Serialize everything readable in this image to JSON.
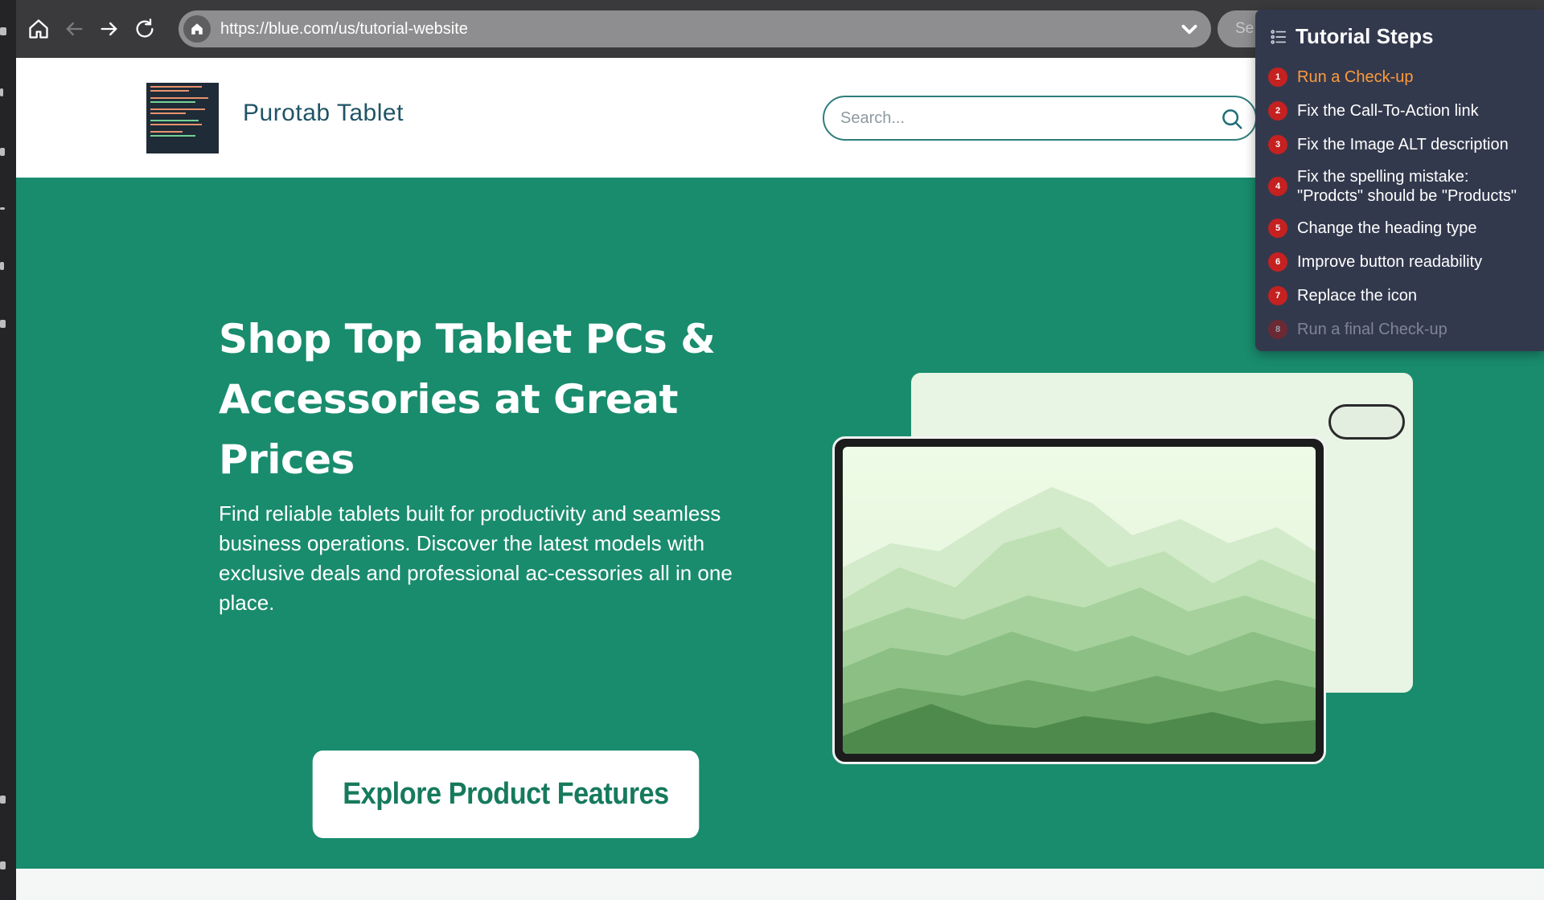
{
  "browser": {
    "url": "https://blue.com/us/tutorial-website",
    "search_placeholder": "Se",
    "icons": {
      "home": "home-icon",
      "back": "arrow-left-icon",
      "forward": "arrow-right-icon",
      "reload": "reload-icon",
      "site_info": "home-icon",
      "dropdown": "chevron-down-icon"
    }
  },
  "site": {
    "brand_name": "Purotab Tablet",
    "search_placeholder": "Search...",
    "hero": {
      "title": "Shop Top Tablet PCs & Accessories at Great Prices",
      "description": "Find reliable tablets built for productivity and seamless business operations. Discover the latest models with exclusive deals and professional ac-cessories all in one place.",
      "cta_label": "Explore Product Features"
    }
  },
  "tutorial": {
    "title": "Tutorial Steps",
    "steps": [
      {
        "number": "1",
        "label": "Run a Check-up",
        "state": "active"
      },
      {
        "number": "2",
        "label": "Fix the Call-To-Action link",
        "state": "todo"
      },
      {
        "number": "3",
        "label": "Fix the Image ALT description",
        "state": "todo"
      },
      {
        "number": "4",
        "label": "Fix the spelling mistake:",
        "label2": "\"Prodcts\" should be \"Products\"",
        "state": "todo"
      },
      {
        "number": "5",
        "label": "Change the heading type",
        "state": "todo"
      },
      {
        "number": "6",
        "label": "Improve button readability",
        "state": "todo"
      },
      {
        "number": "7",
        "label": "Replace the icon",
        "state": "todo"
      },
      {
        "number": "8",
        "label": "Run a final Check-up",
        "state": "disabled"
      }
    ]
  },
  "colors": {
    "hero_bg": "#198c6d",
    "brand_text": "#1f5466",
    "cta_text": "#167a5c",
    "tutorial_bg": "#33394d",
    "step_badge": "#c52121",
    "active_step": "#ff9a3c"
  }
}
